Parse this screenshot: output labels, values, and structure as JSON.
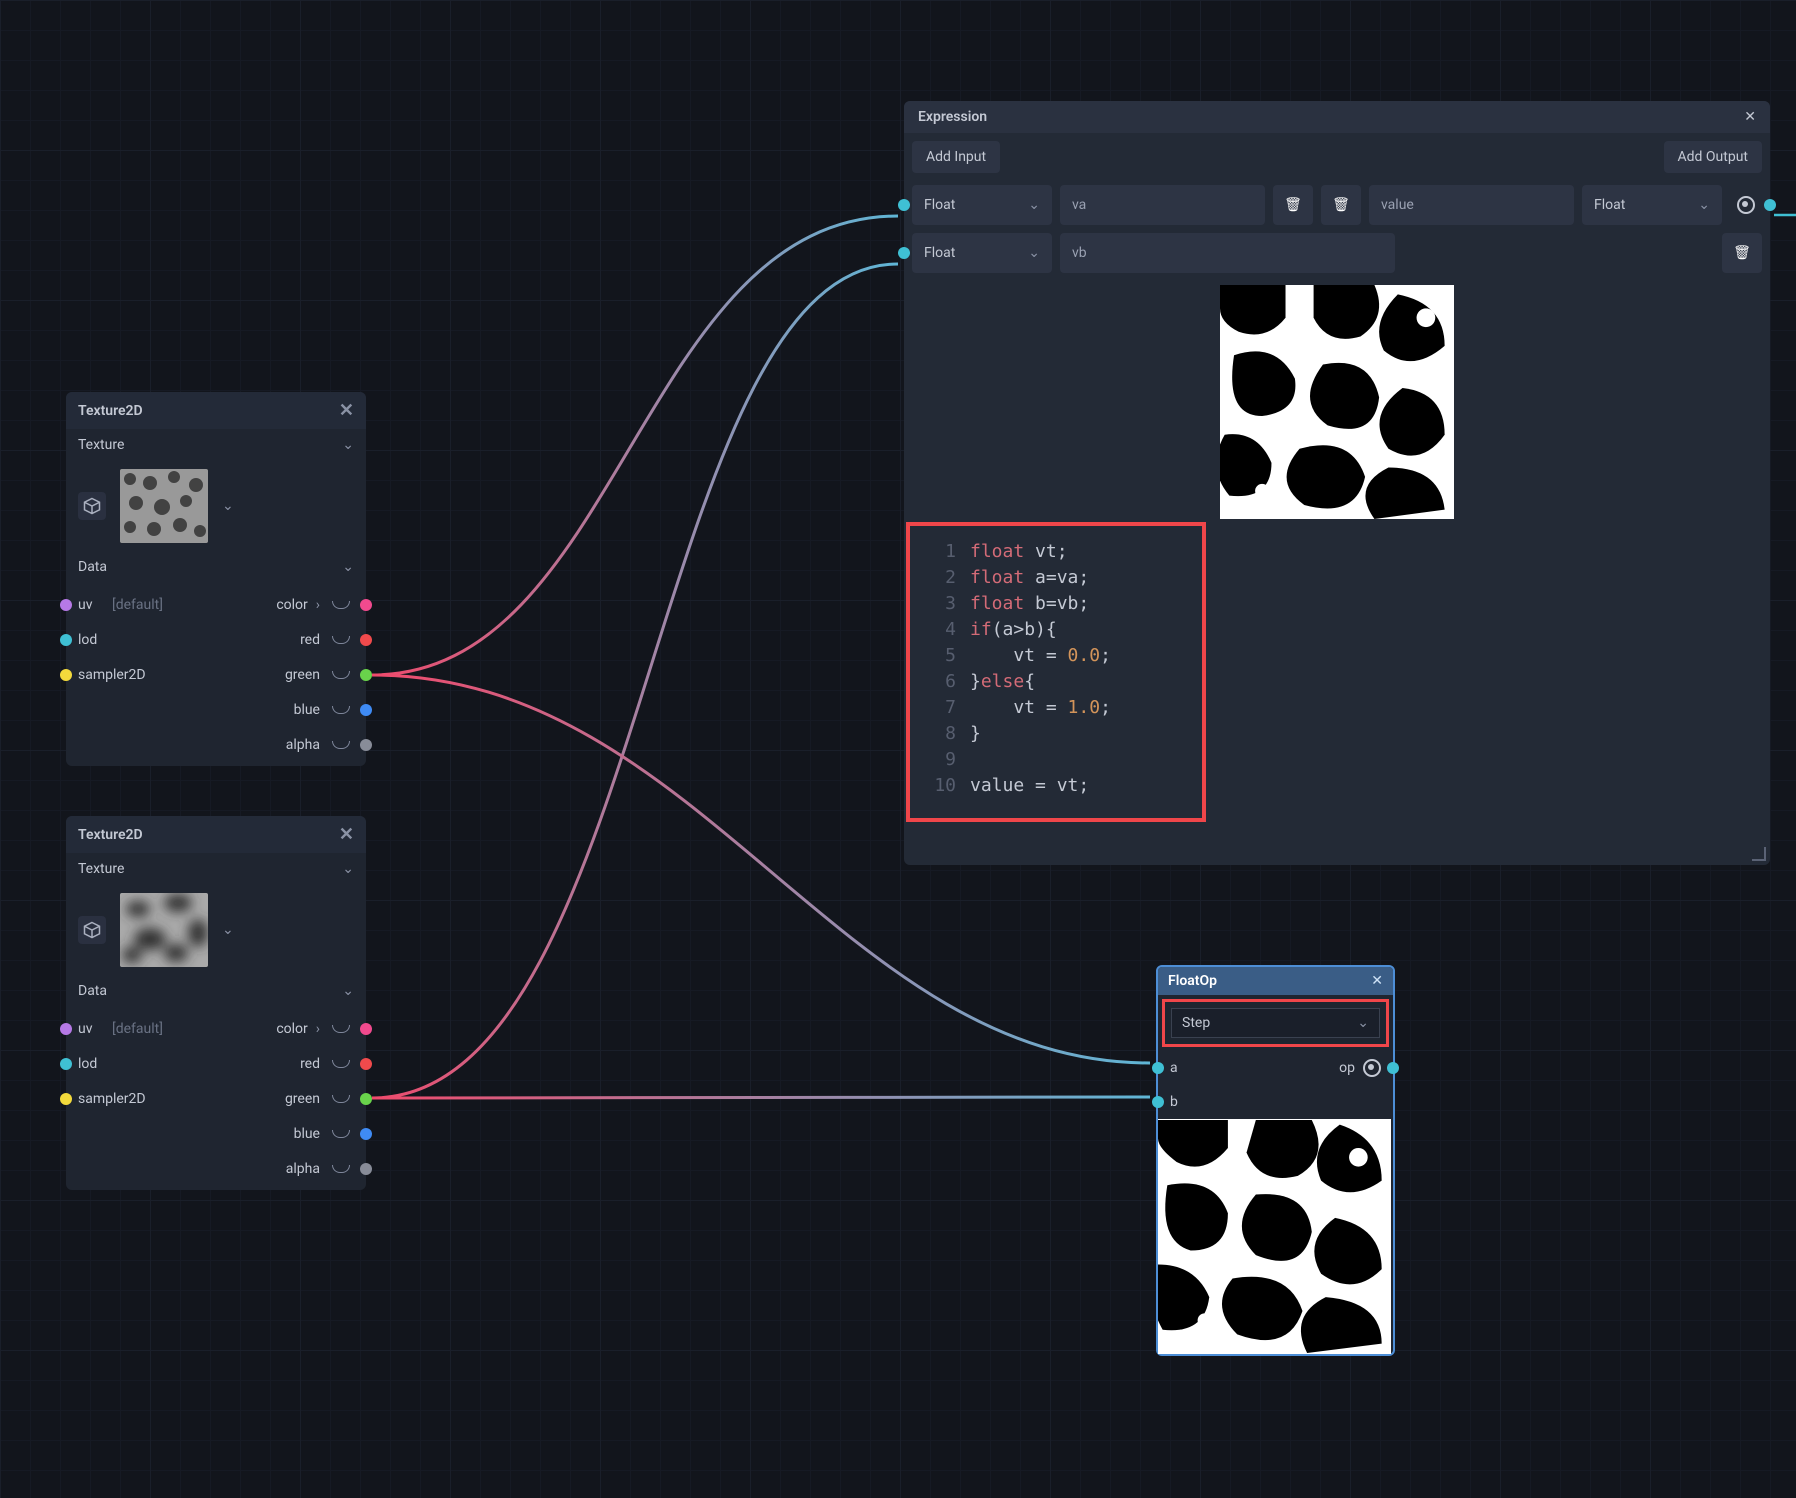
{
  "texture_nodes": [
    {
      "title": "Texture2D",
      "texture_label": "Texture",
      "data_label": "Data",
      "inputs": {
        "uv": "uv",
        "uv_default": "[default]",
        "lod": "lod",
        "sampler": "sampler2D"
      },
      "outputs": {
        "color": "color",
        "red": "red",
        "green": "green",
        "blue": "blue",
        "alpha": "alpha"
      }
    },
    {
      "title": "Texture2D",
      "texture_label": "Texture",
      "data_label": "Data",
      "inputs": {
        "uv": "uv",
        "uv_default": "[default]",
        "lod": "lod",
        "sampler": "sampler2D"
      },
      "outputs": {
        "color": "color",
        "red": "red",
        "green": "green",
        "blue": "blue",
        "alpha": "alpha"
      }
    }
  ],
  "expression": {
    "title": "Expression",
    "add_input": "Add Input",
    "add_output": "Add Output",
    "inputs": [
      {
        "type": "Float",
        "name": "va"
      },
      {
        "type": "Float",
        "name": "vb"
      }
    ],
    "outputs": [
      {
        "type": "Float",
        "name": "value"
      }
    ],
    "code": [
      "float vt;",
      "float a=va;",
      "float b=vb;",
      "if(a>b){",
      "    vt = 0.0;",
      "}else{",
      "    vt = 1.0;",
      "}",
      "",
      "value = vt;"
    ]
  },
  "floatop": {
    "title": "FloatOp",
    "op": "Step",
    "in_a": "a",
    "in_b": "b",
    "out_label": "op"
  },
  "colors": {
    "red_accent": "#f0464a",
    "cyan": "#3fc0d4",
    "pink": "#f14a8e"
  }
}
